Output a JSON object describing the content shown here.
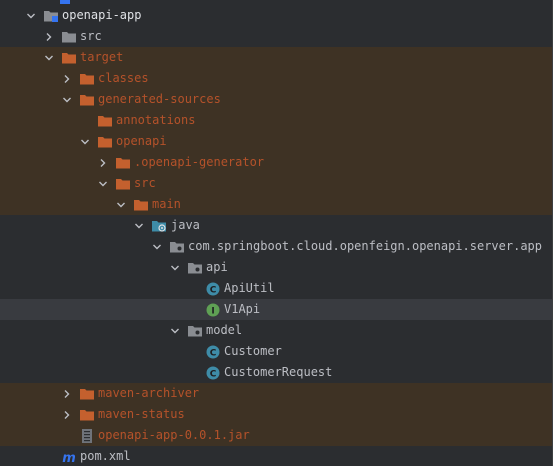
{
  "tree": {
    "rows": [
      {
        "label": "openapi-app",
        "icon": "module-folder-icon",
        "arrow": "expanded"
      },
      {
        "label": "src",
        "icon": "folder-icon",
        "arrow": "collapsed"
      },
      {
        "label": "target",
        "icon": "excluded-folder-icon",
        "arrow": "expanded"
      },
      {
        "label": "classes",
        "icon": "excluded-folder-icon",
        "arrow": "collapsed"
      },
      {
        "label": "generated-sources",
        "icon": "excluded-folder-icon",
        "arrow": "expanded"
      },
      {
        "label": "annotations",
        "icon": "excluded-folder-icon",
        "arrow": "none"
      },
      {
        "label": "openapi",
        "icon": "excluded-folder-icon",
        "arrow": "expanded"
      },
      {
        "label": ".openapi-generator",
        "icon": "excluded-folder-icon",
        "arrow": "collapsed"
      },
      {
        "label": "src",
        "icon": "excluded-folder-icon",
        "arrow": "expanded"
      },
      {
        "label": "main",
        "icon": "excluded-folder-icon",
        "arrow": "expanded"
      },
      {
        "label": "java",
        "icon": "generated-source-root-icon",
        "arrow": "expanded"
      },
      {
        "label": "com.springboot.cloud.openfeign.openapi.server.app",
        "icon": "package-icon",
        "arrow": "expanded"
      },
      {
        "label": "api",
        "icon": "package-icon",
        "arrow": "expanded"
      },
      {
        "label": "ApiUtil",
        "icon": "class-icon",
        "arrow": "none"
      },
      {
        "label": "V1Api",
        "icon": "interface-icon",
        "arrow": "none"
      },
      {
        "label": "model",
        "icon": "package-icon",
        "arrow": "expanded"
      },
      {
        "label": "Customer",
        "icon": "class-icon",
        "arrow": "none"
      },
      {
        "label": "CustomerRequest",
        "icon": "class-icon",
        "arrow": "none"
      },
      {
        "label": "maven-archiver",
        "icon": "excluded-folder-icon",
        "arrow": "collapsed"
      },
      {
        "label": "maven-status",
        "icon": "excluded-folder-icon",
        "arrow": "collapsed"
      },
      {
        "label": "openapi-app-0.0.1.jar",
        "icon": "jar-icon",
        "arrow": "none"
      },
      {
        "label": "pom.xml",
        "icon": "maven-icon",
        "arrow": "none"
      }
    ]
  },
  "colors": {
    "background": "#2b2d30",
    "excluded_row": "#3e3224",
    "selected_row": "#393b40",
    "excluded_text": "#b5522a",
    "text": "#bcbec4",
    "class_icon": "#3e8ca8",
    "interface_icon": "#5fa054",
    "folder": "#8a8d92",
    "excluded_folder": "#c4602e"
  }
}
